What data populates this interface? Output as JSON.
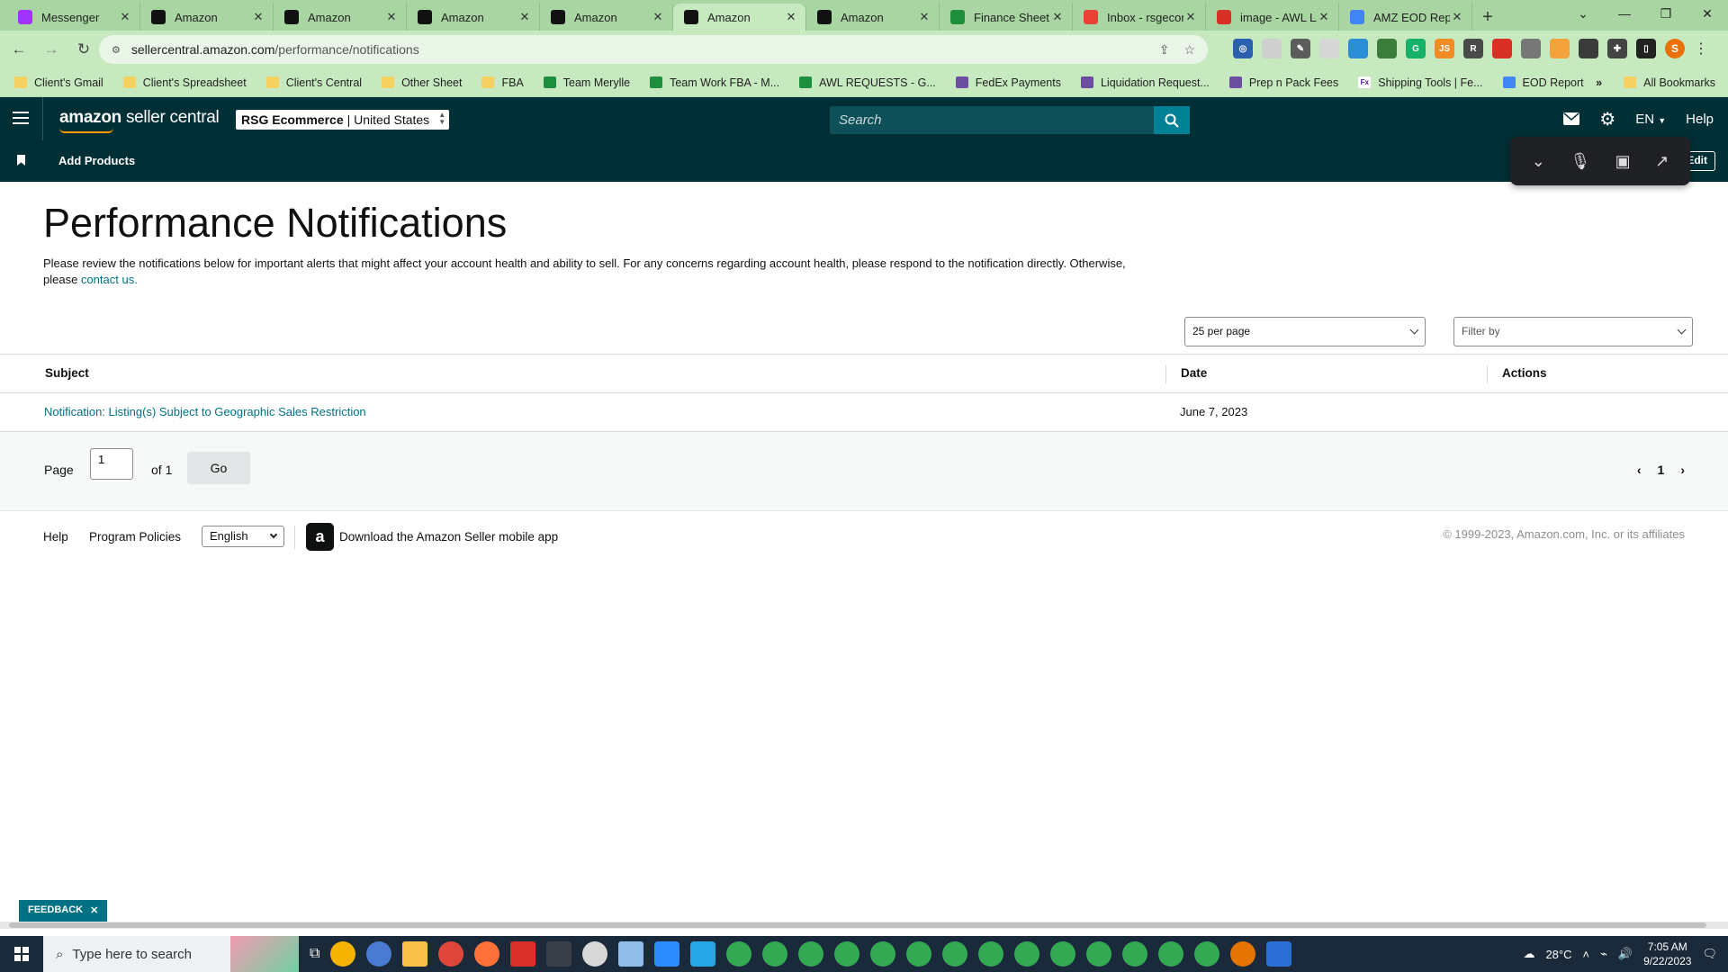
{
  "browser": {
    "tabs": [
      {
        "title": "Messenger",
        "icon": "messenger-icon",
        "color": "#a033ff"
      },
      {
        "title": "Amazon",
        "icon": "amazon-icon",
        "color": "#111111"
      },
      {
        "title": "Amazon",
        "icon": "amazon-icon",
        "color": "#111111"
      },
      {
        "title": "Amazon",
        "icon": "amazon-icon",
        "color": "#111111"
      },
      {
        "title": "Amazon",
        "icon": "amazon-icon",
        "color": "#111111"
      },
      {
        "title": "Amazon",
        "icon": "amazon-icon",
        "color": "#111111",
        "active": true
      },
      {
        "title": "Amazon",
        "icon": "amazon-icon",
        "color": "#111111"
      },
      {
        "title": "Finance Sheet -",
        "icon": "sheets-icon",
        "color": "#1e8e3e"
      },
      {
        "title": "Inbox - rsgecon",
        "icon": "gmail-icon",
        "color": "#ea4335"
      },
      {
        "title": "image - AWL LA",
        "icon": "awl-icon",
        "color": "#d93025"
      },
      {
        "title": "AMZ EOD Repo",
        "icon": "eod-icon",
        "color": "#4285f4"
      }
    ],
    "url_host": "sellercentral.amazon.com",
    "url_path": "/performance/notifications",
    "bookmarks": [
      {
        "label": "Client's Gmail",
        "kind": "folder"
      },
      {
        "label": "Client's Spreadsheet",
        "kind": "folder"
      },
      {
        "label": "Client's Central",
        "kind": "folder"
      },
      {
        "label": "Other Sheet",
        "kind": "folder"
      },
      {
        "label": "FBA",
        "kind": "folder"
      },
      {
        "label": "Team Merylle",
        "kind": "sheet"
      },
      {
        "label": "Team Work FBA - M...",
        "kind": "sheet"
      },
      {
        "label": "AWL REQUESTS - G...",
        "kind": "sheet"
      },
      {
        "label": "FedEx Payments",
        "kind": "form"
      },
      {
        "label": "Liquidation Request...",
        "kind": "form"
      },
      {
        "label": "Prep n Pack Fees",
        "kind": "form"
      },
      {
        "label": "Shipping Tools | Fe...",
        "kind": "fedex"
      },
      {
        "label": "EOD Report",
        "kind": "eod"
      }
    ],
    "all_bookmarks": "All Bookmarks",
    "profile_initial": "S"
  },
  "header": {
    "logo_main": "amazon",
    "logo_sub": "seller central",
    "account_name": "RSG Ecommerce",
    "account_region": "| United States",
    "search_placeholder": "Search",
    "language": "EN",
    "help": "Help",
    "add_products": "Add Products",
    "edit": "Edit"
  },
  "page": {
    "title": "Performance Notifications",
    "intro": "Please review the notifications below for important alerts that might affect your account health and ability to sell. For any concerns regarding account health, please respond to the notification directly. Otherwise, please",
    "intro_link": "contact us.",
    "per_page": "25 per page",
    "filter_placeholder": "Filter by",
    "columns": {
      "subject": "Subject",
      "date": "Date",
      "actions": "Actions"
    },
    "rows": [
      {
        "subject": "Notification: Listing(s) Subject to Geographic Sales Restriction",
        "date": "June 7, 2023",
        "actions": ""
      }
    ],
    "pager": {
      "page_label": "Page",
      "page_value": "1",
      "of_label": "of 1",
      "go": "Go",
      "current": "1"
    }
  },
  "footer": {
    "help": "Help",
    "policies": "Program Policies",
    "language": "English",
    "app_text": "Download the Amazon Seller mobile app",
    "copyright": "© 1999-2023, Amazon.com, Inc. or its affiliates"
  },
  "feedback": "FEEDBACK",
  "taskbar": {
    "search_placeholder": "Type here to search",
    "weather": "28°C",
    "time": "7:05 AM",
    "date": "9/22/2023"
  }
}
